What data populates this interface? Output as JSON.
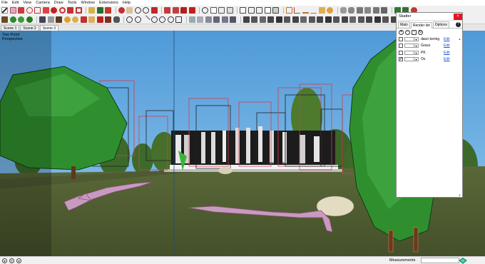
{
  "menu": [
    "File",
    "Edit",
    "View",
    "Camera",
    "Draw",
    "Tools",
    "Window",
    "Extensions",
    "Help"
  ],
  "scenes": [
    {
      "label": "Scene 1",
      "active": false
    },
    {
      "label": "Scene 2",
      "active": false
    },
    {
      "label": "Scene 3",
      "active": true
    }
  ],
  "viewport": {
    "projection_line1": "Two Point",
    "projection_line2": "Perspective"
  },
  "skatter": {
    "title": "Skatter",
    "close": "×",
    "tabs": [
      "Main",
      "Render list",
      "Options"
    ],
    "active_tab": "Render list",
    "help": "?",
    "items": [
      {
        "name": "daun kering",
        "checked": false,
        "edit": "Edit"
      },
      {
        "name": "Grass",
        "checked": false,
        "edit": "Edit"
      },
      {
        "name": "PK",
        "checked": false,
        "edit": "Edit"
      },
      {
        "name": "Os",
        "checked": true,
        "edit": "Edit"
      }
    ]
  },
  "status": {
    "measurements_label": "Measurements"
  },
  "colors": {
    "sky": "#5aa3dc",
    "ground": "#4e5a31",
    "tree": "#2f8f2f",
    "roots": "#b884b0",
    "bounds": "#d04050",
    "close_button": "#e81123"
  }
}
